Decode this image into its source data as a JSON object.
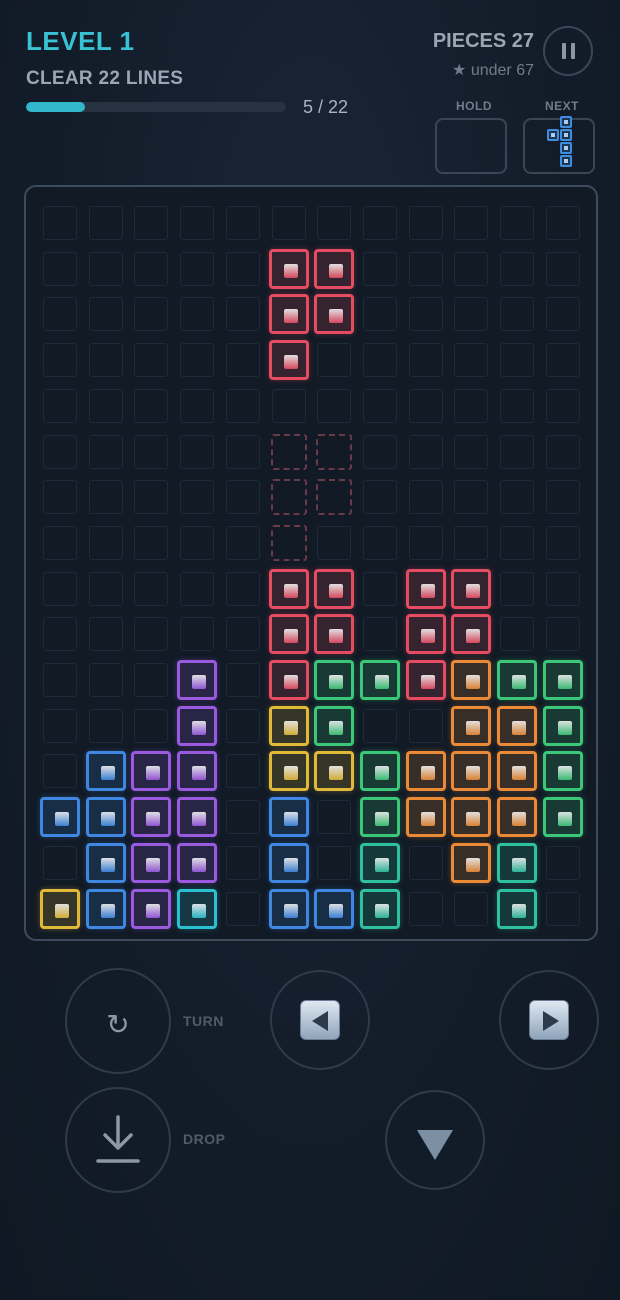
{
  "header": {
    "level": "LEVEL 1",
    "goal": "CLEAR 22 LINES",
    "progress_text": "5 / 22",
    "progress_fraction": 0.227,
    "pieces": "PIECES 27",
    "par": "★ under 67"
  },
  "hold_label": "HOLD",
  "next_label": "NEXT",
  "next_piece": "J",
  "controls": {
    "turn_label": "TURN",
    "drop_label": "DROP",
    "turn_icon": "↻"
  },
  "colors": {
    "red": "#e54c62",
    "green": "#3cc778",
    "purple": "#9a5ae0",
    "blue": "#3f87e0",
    "yellow": "#e2b838",
    "orange": "#ea8a36",
    "teal": "#2fc0a0",
    "cyan": "#2bc0d0",
    "accent": "#38c2d4"
  },
  "board": {
    "cols": 12,
    "rows": 16,
    "rows_data": [
      "............",
      ".....RR.....",
      ".....RR.....",
      ".....R......",
      "............",
      "............",
      "............",
      "............",
      ".....RR.RR..",
      ".....RR.RR..",
      "...P.RGGROGG",
      "...P.YG..OOG",
      ".BPP.YYGOOOG",
      "BBPP.B.GOOOG",
      ".BPP.B.T.OT.",
      "YBPC.BBT..T."
    ],
    "ghost_rows": [
      "............",
      "............",
      "............",
      "............",
      "............",
      ".....gg.....",
      ".....gg.....",
      ".....g......",
      "............",
      "............",
      "............",
      "............",
      "............",
      "............",
      "............",
      "............"
    ]
  }
}
